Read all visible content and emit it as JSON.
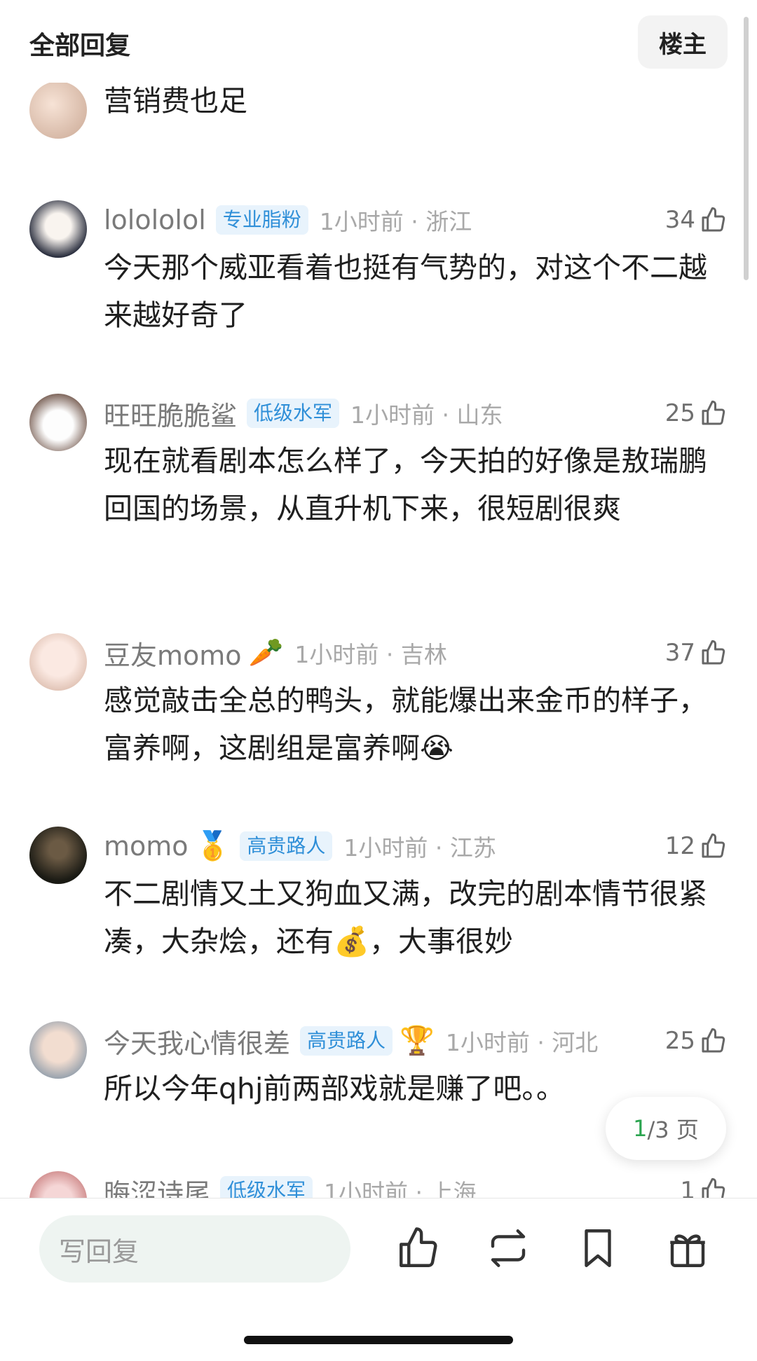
{
  "header": {
    "title": "全部回复",
    "louzhu_label": "楼主"
  },
  "comments": [
    {
      "username": "",
      "tag": "",
      "time": "",
      "likes": "",
      "text": "营销费也足"
    },
    {
      "username": "lolololol",
      "tag": "专业脂粉",
      "time": "1小时前 · 浙江",
      "likes": "34",
      "text": "今天那个威亚看着也挺有气势的，对这个不二越来越好奇了"
    },
    {
      "username": "旺旺脆脆鲨",
      "tag": "低级水军",
      "time": "1小时前 · 山东",
      "likes": "25",
      "text": "现在就看剧本怎么样了，今天拍的好像是敖瑞鹏回国的场景，从直升机下来，很短剧很爽"
    },
    {
      "username": "豆友momo",
      "badge": "🥕",
      "time": "1小时前 · 吉林",
      "likes": "37",
      "text": "感觉敲击全总的鸭头，就能爆出来金币的样子，富养啊，这剧组是富养啊😭"
    },
    {
      "username": "momo",
      "badge": "🥇",
      "tag": "高贵路人",
      "time": "1小时前 · 江苏",
      "likes": "12",
      "text": "不二剧情又土又狗血又满，改完的剧本情节很紧凑，大杂烩，还有💰，大事很妙"
    },
    {
      "username": "今天我心情很差",
      "tag": "高贵路人",
      "badge": "🏆",
      "time": "1小时前 · 河北",
      "likes": "25",
      "text": "所以今年qhj前两部戏就是赚了吧。。"
    },
    {
      "username": "晦涩诗尾",
      "tag": "低级水军",
      "time": "1小时前 · 上海",
      "likes": "1",
      "text": ""
    }
  ],
  "pager": {
    "current": "1",
    "total_label": "/3 页"
  },
  "bottom_bar": {
    "reply_placeholder": "写回复"
  },
  "icons": [
    "thumbs-up-icon",
    "repost-icon",
    "bookmark-icon",
    "gift-icon"
  ],
  "colors": {
    "tag_text": "#2f8fd8",
    "tag_bg": "#e8f3fc",
    "page_current": "#2aa44f"
  }
}
